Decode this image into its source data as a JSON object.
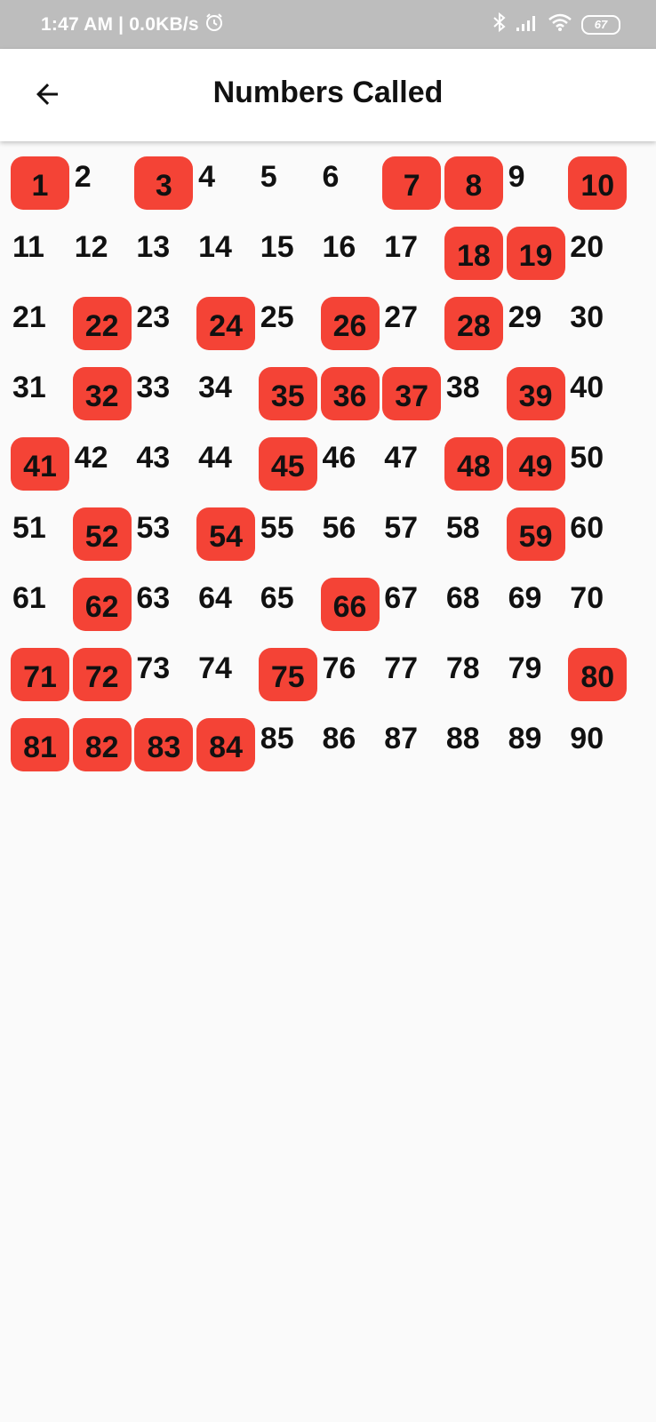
{
  "status_bar": {
    "time_text": "1:47 AM | 0.0KB/s",
    "battery_level": "67",
    "icons": [
      "alarm-icon",
      "bluetooth-icon",
      "signal-icon",
      "wifi-icon",
      "battery-icon"
    ]
  },
  "app_bar": {
    "title": "Numbers Called",
    "back_icon": "arrow-back-icon"
  },
  "colors": {
    "called_bg": "#f44336",
    "page_bg": "#fafafa",
    "status_bar_bg": "#bdbdbd"
  },
  "numbers": {
    "columns": 10,
    "all": [
      1,
      2,
      3,
      4,
      5,
      6,
      7,
      8,
      9,
      10,
      11,
      12,
      13,
      14,
      15,
      16,
      17,
      18,
      19,
      20,
      21,
      22,
      23,
      24,
      25,
      26,
      27,
      28,
      29,
      30,
      31,
      32,
      33,
      34,
      35,
      36,
      37,
      38,
      39,
      40,
      41,
      42,
      43,
      44,
      45,
      46,
      47,
      48,
      49,
      50,
      51,
      52,
      53,
      54,
      55,
      56,
      57,
      58,
      59,
      60,
      61,
      62,
      63,
      64,
      65,
      66,
      67,
      68,
      69,
      70,
      71,
      72,
      73,
      74,
      75,
      76,
      77,
      78,
      79,
      80,
      81,
      82,
      83,
      84,
      85,
      86,
      87,
      88,
      89,
      90
    ],
    "called": [
      1,
      3,
      7,
      8,
      10,
      18,
      19,
      22,
      24,
      26,
      28,
      32,
      35,
      36,
      37,
      39,
      41,
      45,
      48,
      49,
      52,
      54,
      59,
      62,
      66,
      71,
      72,
      75,
      80,
      81,
      82,
      83,
      84
    ]
  }
}
